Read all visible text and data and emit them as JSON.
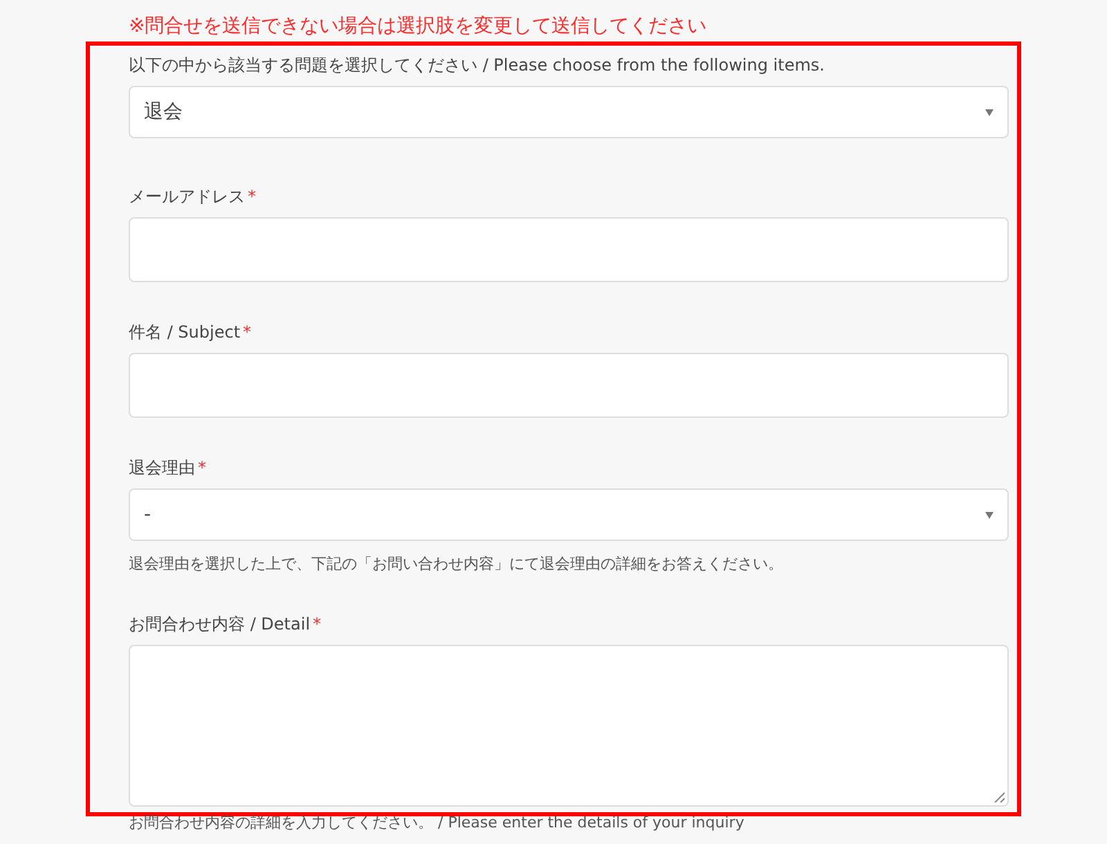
{
  "notice": "※問合せを送信できない場合は選択肢を変更して送信してください",
  "fields": [
    {
      "kind": "select",
      "label": "以下の中から該当する問題を選択してください / Please choose from the following items.",
      "value": "退会"
    },
    {
      "kind": "input",
      "label": "メールアドレス",
      "required_mark": "*"
    },
    {
      "kind": "input",
      "label": "件名 / Subject",
      "required_mark": "*"
    },
    {
      "kind": "select",
      "label": "退会理由",
      "required_mark": "*",
      "value": "-",
      "hint": "退会理由を選択した上で、下記の「お問い合わせ内容」にて退会理由の詳細をお答えください。"
    },
    {
      "kind": "textarea",
      "label": "お問合わせ内容 / Detail",
      "required_mark": "*",
      "hint": "お問合わせ内容の詳細を入力してください。 / Please enter the details of your inquiry"
    }
  ]
}
